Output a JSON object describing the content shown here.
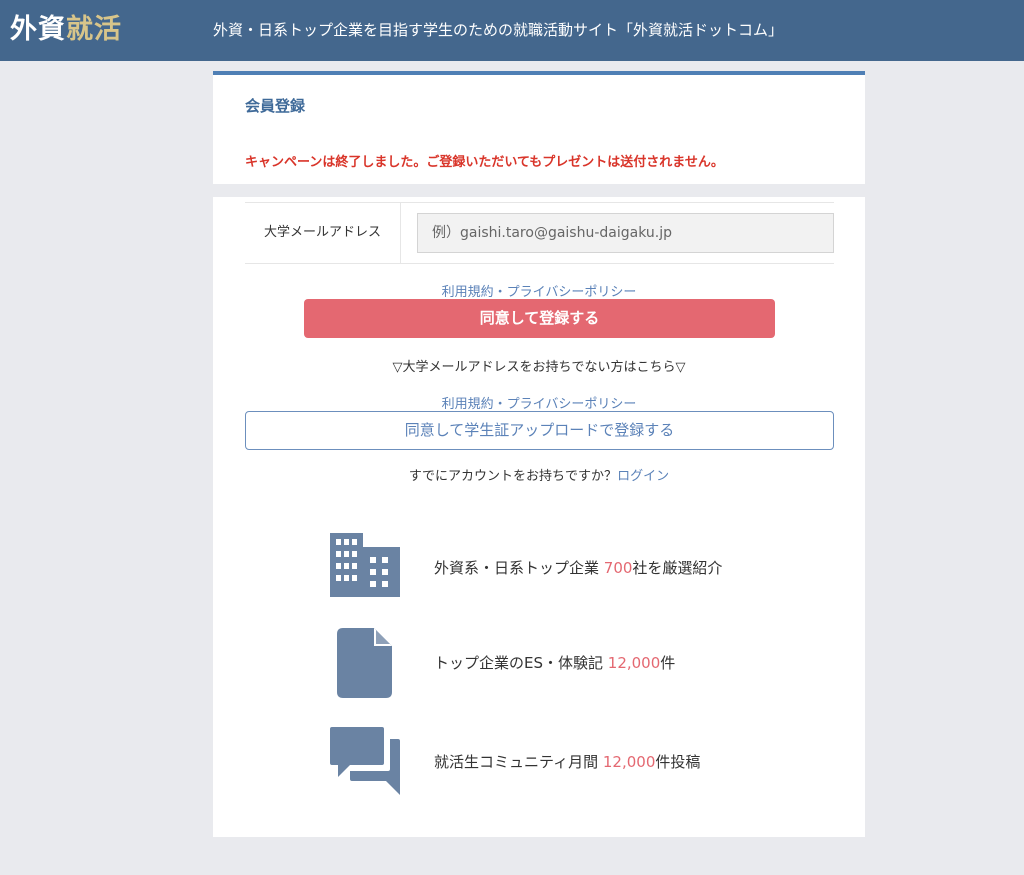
{
  "header": {
    "logo_part1": "外資",
    "logo_part2": "就活",
    "tagline": "外資・日系トップ企業を目指す学生のための就職活動サイト「外資就活ドットコム」"
  },
  "registration": {
    "title": "会員登録",
    "campaign_notice": "キャンペーンは終了しました。ご登録いただいてもプレゼントは送付されません。"
  },
  "form": {
    "email_label": "大学メールアドレス",
    "email_placeholder": "例）gaishi.taro@gaishu-daigaku.jp",
    "email_value": ""
  },
  "terms": {
    "terms_link": "利用規約",
    "separator": "・",
    "privacy_link": "プライバシーポリシー"
  },
  "actions": {
    "agree_register": "同意して登録する",
    "no_univ_email": "▽大学メールアドレスをお持ちでない方はこちら▽",
    "agree_upload_register": "同意して学生証アップロードで登録する",
    "have_account": "すでにアカウントをお持ちですか？",
    "login_link": "ログイン"
  },
  "features": [
    {
      "icon": "building-icon",
      "prefix": "外資系・日系トップ企業 ",
      "number": "700",
      "suffix": "社を厳選紹介"
    },
    {
      "icon": "document-icon",
      "prefix": "トップ企業のES・体験記 ",
      "number": "12,000",
      "suffix": "件"
    },
    {
      "icon": "chat-icon",
      "prefix": "就活生コミュニティ月間 ",
      "number": "12,000",
      "suffix": "件投稿"
    }
  ],
  "colors": {
    "header_bg": "#44678d",
    "accent_blue": "#4f7fb5",
    "primary_button": "#e46871",
    "notice_red": "#d9352a",
    "icon_color": "#6a83a3"
  }
}
